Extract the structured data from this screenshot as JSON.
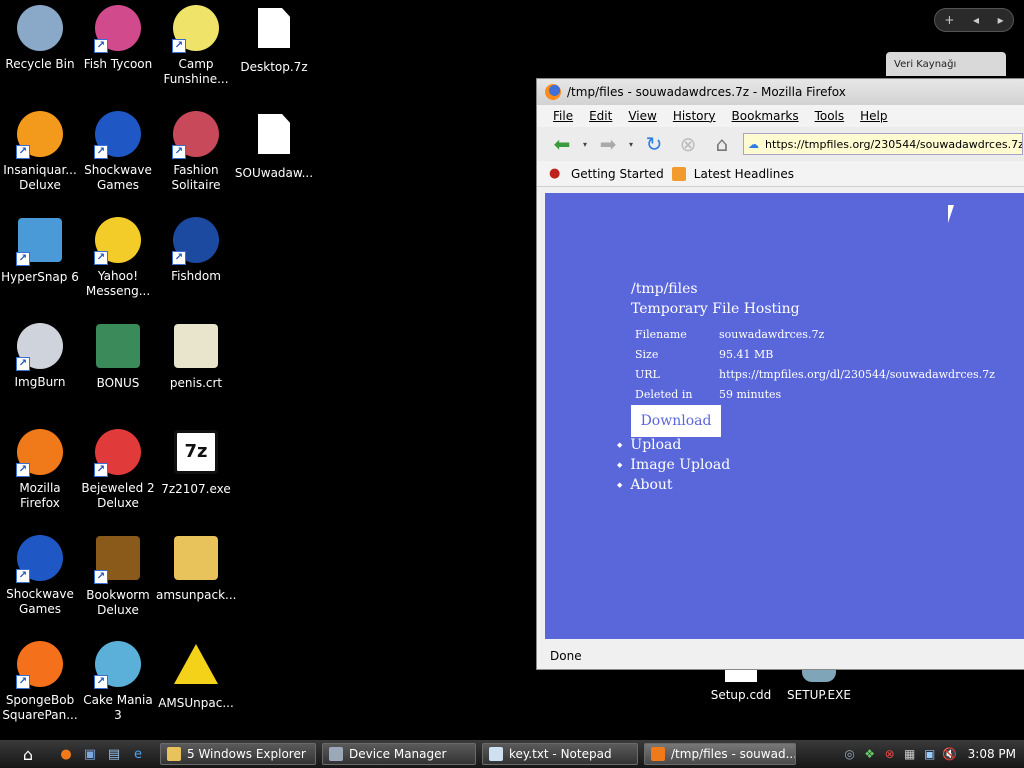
{
  "desktop": {
    "icons": [
      {
        "label": "Recycle Bin",
        "icon": "recycle-bin-icon",
        "color": "#8aa8c8"
      },
      {
        "label": "Fish Tycoon",
        "icon": "fish-tycoon-icon",
        "color": "#d04a8c"
      },
      {
        "label": "Camp\nFunshine...",
        "icon": "camp-funshine-icon",
        "color": "#f0e36a"
      },
      {
        "label": "Desktop.7z",
        "icon": "file-icon",
        "color": "#ffffff"
      },
      {
        "label": "Insaniquar...\nDeluxe",
        "icon": "goldfish-icon",
        "color": "#f39a1c"
      },
      {
        "label": "Shockwave\nGames",
        "icon": "shockwave-icon",
        "color": "#1f58c4"
      },
      {
        "label": "Fashion\nSolitaire",
        "icon": "fashion-solitaire-icon",
        "color": "#c84a5a"
      },
      {
        "label": "SOUwadaw...",
        "icon": "file-icon",
        "color": "#ffffff"
      },
      {
        "label": "HyperSnap 6",
        "icon": "hypersnap-icon",
        "color": "#4a9ad8"
      },
      {
        "label": "Yahoo!\nMesseng...",
        "icon": "yahoo-messenger-icon",
        "color": "#f4cc2a"
      },
      {
        "label": "Fishdom",
        "icon": "fishdom-icon",
        "color": "#1c4aa0"
      },
      {
        "label": "ImgBurn",
        "icon": "imgburn-icon",
        "color": "#cfd4dc"
      },
      {
        "label": "BONUS",
        "icon": "bonus-icon",
        "color": "#3a8a5a"
      },
      {
        "label": "penis.crt",
        "icon": "certificate-icon",
        "color": "#e9e4cc"
      },
      {
        "label": "Mozilla\nFirefox",
        "icon": "firefox-icon",
        "color": "#f07a1a"
      },
      {
        "label": "Bejeweled 2\nDeluxe",
        "icon": "bejeweled-icon",
        "color": "#e03a3a"
      },
      {
        "label": "7z2107.exe",
        "icon": "7zip-icon",
        "color": "#ffffff"
      },
      {
        "label": "Shockwave\nGames",
        "icon": "shockwave-icon",
        "color": "#1f58c4"
      },
      {
        "label": "Bookworm\nDeluxe",
        "icon": "bookworm-icon",
        "color": "#8a5a1a"
      },
      {
        "label": "amsunpack...",
        "icon": "zip-folder-icon",
        "color": "#e8c25a"
      },
      {
        "label": "SpongeBob\nSquarePan...",
        "icon": "nick-icon",
        "color": "#f4701a"
      },
      {
        "label": "Cake Mania 3",
        "icon": "cake-mania-icon",
        "color": "#5ab0d8"
      },
      {
        "label": "AMSUnpac...",
        "icon": "warning-icon",
        "color": "#f4d21a"
      }
    ],
    "bg_files": [
      {
        "label": "Setup.cdd",
        "icon": "file-icon"
      },
      {
        "label": "SETUP.EXE",
        "icon": "setup-icon"
      }
    ]
  },
  "gadget": {
    "add": "+",
    "prev": "◂",
    "next": "▸",
    "tab_label": "Veri Kaynağı"
  },
  "firefox": {
    "title": "/tmp/files - souwadawdrces.7z - Mozilla Firefox",
    "menu": [
      "File",
      "Edit",
      "View",
      "History",
      "Bookmarks",
      "Tools",
      "Help"
    ],
    "url": "https://tmpfiles.org/230544/souwadawdrces.7z",
    "bookmarks": [
      "Getting Started",
      "Latest Headlines"
    ],
    "status": "Done",
    "page": {
      "heading": "/tmp/files",
      "subheading": "Temporary File Hosting",
      "rows": [
        {
          "key": "Filename",
          "value": "souwadawdrces.7z"
        },
        {
          "key": "Size",
          "value": "95.41 MB"
        },
        {
          "key": "URL",
          "value": "https://tmpfiles.org/dl/230544/souwadawdrces.7z"
        },
        {
          "key": "Deleted in",
          "value": "59 minutes"
        }
      ],
      "download_label": "Download",
      "links": [
        "Upload",
        "Image Upload",
        "About"
      ]
    }
  },
  "taskbar": {
    "tasks": [
      {
        "label": "5 Windows Explorer",
        "icon": "folder-icon"
      },
      {
        "label": "Device Manager",
        "icon": "device-manager-icon"
      },
      {
        "label": "key.txt - Notepad",
        "icon": "notepad-icon"
      },
      {
        "label": "/tmp/files - souwad...",
        "icon": "firefox-icon"
      }
    ],
    "clock": "3:08 PM"
  }
}
